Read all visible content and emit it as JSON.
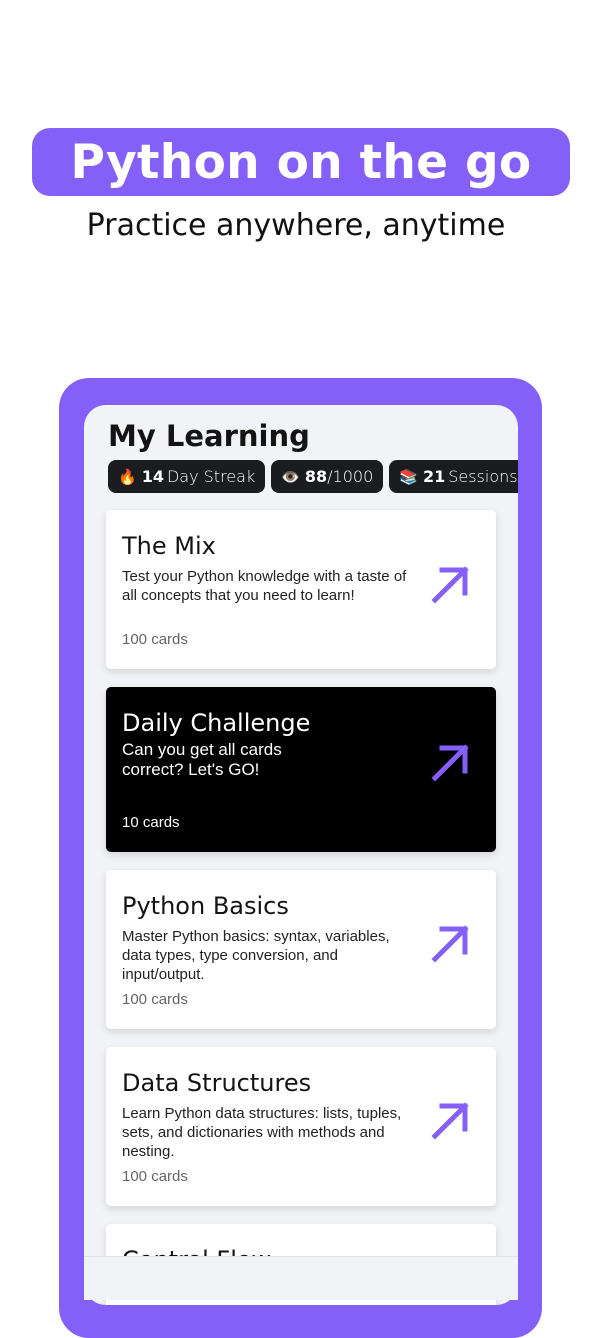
{
  "banner": {
    "title": "Python on the go"
  },
  "subtitle": "Practice anywhere, anytime",
  "app": {
    "heading": "My Learning",
    "stats": [
      {
        "icon": "🔥",
        "value": "14",
        "label": "Day Streak"
      },
      {
        "icon": "👁️",
        "value": "88",
        "label": "/1000"
      },
      {
        "icon": "📚",
        "value": "21",
        "label": "Sessions"
      }
    ],
    "cards": [
      {
        "title": "The Mix",
        "description": "Test your Python knowledge with a taste of all concepts that you need to learn!",
        "count": "100 cards",
        "theme": "light"
      },
      {
        "title": "Daily Challenge",
        "description": "Can you get all cards correct? Let's GO!",
        "count": "10 cards",
        "theme": "dark"
      },
      {
        "title": "Python Basics",
        "description": "Master Python basics: syntax, variables, data types, type conversion, and input/output.",
        "count": "100 cards",
        "theme": "light"
      },
      {
        "title": "Data Structures",
        "description": "Learn Python data structures: lists, tuples, sets, and dictionaries with methods and nesting.",
        "count": "100 cards",
        "theme": "light"
      },
      {
        "title": "Control Flow",
        "theme": "light"
      }
    ]
  },
  "colors": {
    "accent": "#8460f9",
    "dark_card": "#000000",
    "stat_bg": "#1b1c1f",
    "screen_bg": "#f1f3f6"
  }
}
